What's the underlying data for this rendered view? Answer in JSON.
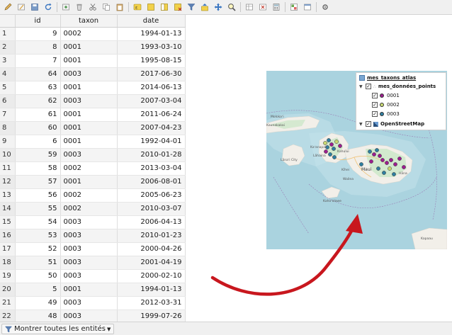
{
  "toolbar": {
    "buttons": [
      {
        "icon": "pencil-toggle-edit-icon"
      },
      {
        "icon": "multi-edit-icon"
      },
      {
        "icon": "save-edits-icon"
      },
      {
        "icon": "reload-icon"
      },
      {
        "icon": "add-feature-icon"
      },
      {
        "icon": "delete-feature-icon"
      },
      {
        "icon": "cut-icon"
      },
      {
        "icon": "copy-icon"
      },
      {
        "icon": "paste-icon"
      },
      {
        "icon": "select-by-expression-icon"
      },
      {
        "icon": "select-all-icon"
      },
      {
        "icon": "invert-selection-icon"
      },
      {
        "icon": "deselect-all-icon"
      },
      {
        "icon": "filter-select-icon"
      },
      {
        "icon": "move-selection-to-top-icon"
      },
      {
        "icon": "pan-to-selection-icon"
      },
      {
        "icon": "zoom-to-selection-icon"
      },
      {
        "icon": "new-field-icon"
      },
      {
        "icon": "delete-field-icon"
      },
      {
        "icon": "field-calculator-icon"
      },
      {
        "icon": "conditional-formatting-icon"
      },
      {
        "icon": "dock-icon"
      },
      {
        "icon": "actions-icon"
      }
    ]
  },
  "table": {
    "columns": [
      "id",
      "taxon",
      "date"
    ],
    "rows": [
      {
        "n": "1",
        "id": "9",
        "taxon": "0002",
        "date": "1994-01-13"
      },
      {
        "n": "2",
        "id": "8",
        "taxon": "0001",
        "date": "1993-03-10"
      },
      {
        "n": "3",
        "id": "7",
        "taxon": "0001",
        "date": "1995-08-15"
      },
      {
        "n": "4",
        "id": "64",
        "taxon": "0003",
        "date": "2017-06-30"
      },
      {
        "n": "5",
        "id": "63",
        "taxon": "0001",
        "date": "2014-06-13"
      },
      {
        "n": "6",
        "id": "62",
        "taxon": "0003",
        "date": "2007-03-04"
      },
      {
        "n": "7",
        "id": "61",
        "taxon": "0001",
        "date": "2011-06-24"
      },
      {
        "n": "8",
        "id": "60",
        "taxon": "0001",
        "date": "2007-04-23"
      },
      {
        "n": "9",
        "id": "6",
        "taxon": "0001",
        "date": "1992-04-01"
      },
      {
        "n": "10",
        "id": "59",
        "taxon": "0003",
        "date": "2010-01-28"
      },
      {
        "n": "11",
        "id": "58",
        "taxon": "0002",
        "date": "2013-03-04"
      },
      {
        "n": "12",
        "id": "57",
        "taxon": "0001",
        "date": "2006-08-01"
      },
      {
        "n": "13",
        "id": "56",
        "taxon": "0002",
        "date": "2005-06-23"
      },
      {
        "n": "14",
        "id": "55",
        "taxon": "0002",
        "date": "2010-03-07"
      },
      {
        "n": "15",
        "id": "54",
        "taxon": "0003",
        "date": "2006-04-13"
      },
      {
        "n": "16",
        "id": "53",
        "taxon": "0003",
        "date": "2010-01-23"
      },
      {
        "n": "17",
        "id": "52",
        "taxon": "0003",
        "date": "2000-04-26"
      },
      {
        "n": "18",
        "id": "51",
        "taxon": "0003",
        "date": "2001-04-19"
      },
      {
        "n": "19",
        "id": "50",
        "taxon": "0003",
        "date": "2000-02-10"
      },
      {
        "n": "20",
        "id": "5",
        "taxon": "0001",
        "date": "1994-01-13"
      },
      {
        "n": "21",
        "id": "49",
        "taxon": "0003",
        "date": "2012-03-31"
      },
      {
        "n": "22",
        "id": "48",
        "taxon": "0003",
        "date": "1999-07-26"
      }
    ]
  },
  "filter": {
    "label": "Montrer toutes les entités",
    "icon": "filter-funnel-icon"
  },
  "map": {
    "place_labels": [
      {
        "text": "Molokaʻi"
      },
      {
        "text": "Kaunakakai"
      },
      {
        "text": "Kaʻanapali"
      },
      {
        "text": "Lāhaina"
      },
      {
        "text": "Lānaʻi City"
      },
      {
        "text": "Kahului"
      },
      {
        "text": "Kīhei"
      },
      {
        "text": "Maui"
      },
      {
        "text": "Wailea"
      },
      {
        "text": "Hāna"
      },
      {
        "text": "Kahoʻolawe"
      },
      {
        "text": "Kapaau"
      }
    ],
    "legend": {
      "group_name": "mes_taxons_atlas",
      "layer_name": "mes_données_points",
      "classes": [
        {
          "label": "0001",
          "color": "#9b1f8e"
        },
        {
          "label": "0002",
          "color": "#c8d873"
        },
        {
          "label": "0003",
          "color": "#2f7ea0"
        }
      ],
      "basemap_name": "OpenStreetMap"
    }
  },
  "colors": {
    "sea": "#aad3df",
    "land": "#f2efe9",
    "vegetation": "#cde7c9",
    "arrow": "#c8171e"
  }
}
